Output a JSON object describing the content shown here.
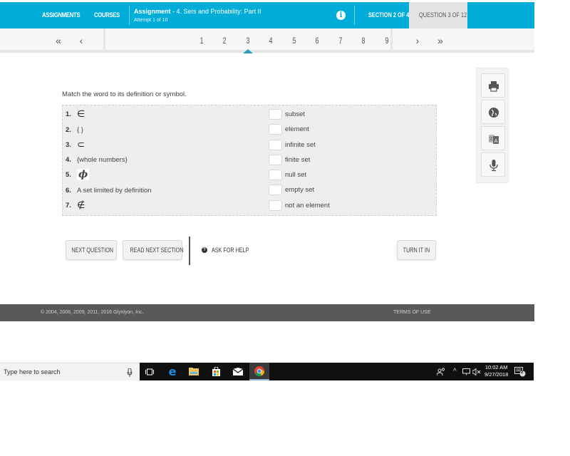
{
  "header": {
    "nav_assignments": "ASSIGNMENTS",
    "nav_courses": "COURSES",
    "assignment_label": "Assignment",
    "assignment_title": " - 4. Sets and Probability: Part II",
    "attempt": "Attempt 1 of 10",
    "info_icon": "i",
    "section": "SECTION 2 OF 4",
    "question": "QUESTION 3 OF 12",
    "accent_color": "#00acd8"
  },
  "pager": {
    "first": "«",
    "prev": "‹",
    "pages": [
      "1",
      "2",
      "3",
      "4",
      "5",
      "6",
      "7",
      "8",
      "9"
    ],
    "current_page": "3",
    "next": "›",
    "last": "»"
  },
  "question": {
    "prompt": "Match the word to its definition or symbol.",
    "items": [
      {
        "num": "1.",
        "term": "∈"
      },
      {
        "num": "2.",
        "term": "{ }"
      },
      {
        "num": "3.",
        "term": "⊂"
      },
      {
        "num": "4.",
        "term": "{whole numbers}"
      },
      {
        "num": "5.",
        "term": "ϕ"
      },
      {
        "num": "6.",
        "term": "A set limited by definition"
      },
      {
        "num": "7.",
        "term": "∉"
      }
    ],
    "answers": [
      {
        "value": "",
        "label": "subset"
      },
      {
        "value": "",
        "label": "element"
      },
      {
        "value": "",
        "label": "infinite set"
      },
      {
        "value": "",
        "label": "finite set"
      },
      {
        "value": "",
        "label": "null set"
      },
      {
        "value": "",
        "label": "empty set"
      },
      {
        "value": "",
        "label": "not an element"
      }
    ]
  },
  "tools": [
    "print-icon",
    "globe-icon",
    "translate-icon",
    "microphone-icon"
  ],
  "actions": {
    "next_question": "NEXT QUESTION",
    "read_next_section": "READ NEXT SECTION",
    "ask_for_help": "ASK FOR HELP",
    "help_icon": "?",
    "turn_it_in": "TURN IT IN"
  },
  "footer": {
    "copyright": "© 2004, 2006, 2009, 2011, 2016 Glynlyon, Inc.",
    "terms": "TERMS OF USE"
  },
  "taskbar": {
    "search_placeholder": "Type here to search",
    "time": "10:02 AM",
    "date": "9/27/2018",
    "notification_count": "2"
  }
}
